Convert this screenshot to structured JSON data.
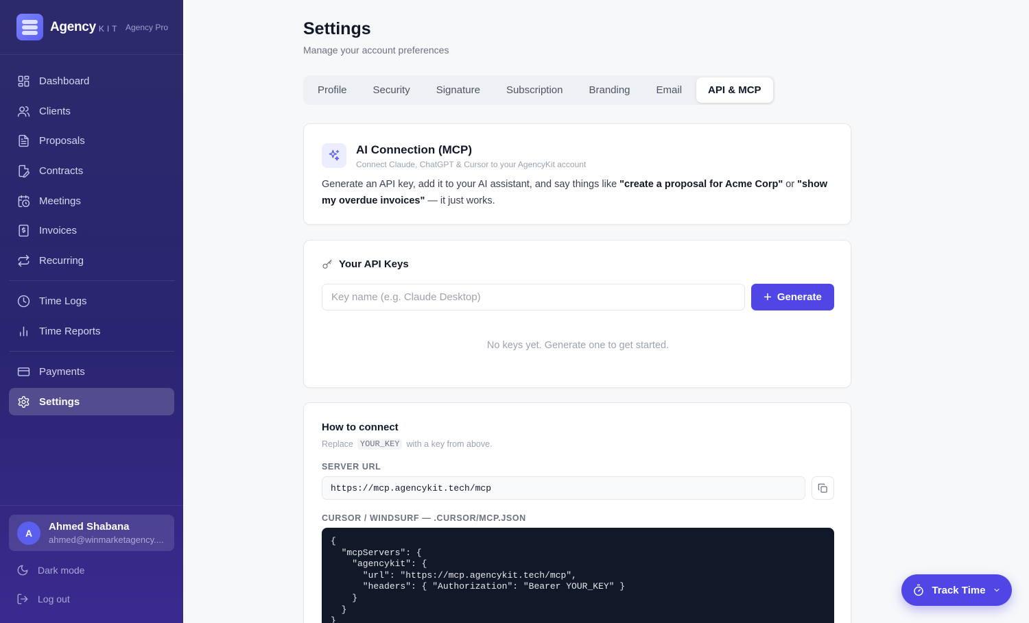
{
  "brand": {
    "name": "Agency",
    "suffix": "KIT",
    "plan": "Agency Pro"
  },
  "nav": {
    "items": [
      {
        "label": "Dashboard",
        "icon": "dashboard-icon"
      },
      {
        "label": "Clients",
        "icon": "users-icon"
      },
      {
        "label": "Proposals",
        "icon": "document-icon"
      },
      {
        "label": "Contracts",
        "icon": "contract-icon"
      },
      {
        "label": "Meetings",
        "icon": "calendar-clock-icon"
      },
      {
        "label": "Invoices",
        "icon": "invoice-icon"
      },
      {
        "label": "Recurring",
        "icon": "repeat-icon"
      },
      {
        "label": "Time Logs",
        "icon": "clock-icon"
      },
      {
        "label": "Time Reports",
        "icon": "bar-chart-icon"
      },
      {
        "label": "Payments",
        "icon": "credit-card-icon"
      },
      {
        "label": "Settings",
        "icon": "gear-icon",
        "active": true
      }
    ]
  },
  "user": {
    "initial": "A",
    "name": "Ahmed Shabana",
    "email": "ahmed@winmarketagency...."
  },
  "footer": {
    "dark_mode": "Dark mode",
    "logout": "Log out"
  },
  "page": {
    "title": "Settings",
    "subtitle": "Manage your account preferences"
  },
  "tabs": [
    "Profile",
    "Security",
    "Signature",
    "Subscription",
    "Branding",
    "Email",
    "API & MCP"
  ],
  "active_tab": "API & MCP",
  "mcp": {
    "title": "AI Connection (MCP)",
    "subtitle": "Connect Claude, ChatGPT & Cursor to your AgencyKit account",
    "desc_part1": "Generate an API key, add it to your AI assistant, and say things like ",
    "desc_bold1": "\"create a proposal for Acme Corp\"",
    "desc_part2": " or ",
    "desc_bold2": "\"show my overdue invoices\"",
    "desc_part3": " — it just works."
  },
  "keys": {
    "title": "Your API Keys",
    "placeholder": "Key name (e.g. Claude Desktop)",
    "value": "",
    "generate_label": "Generate",
    "empty": "No keys yet. Generate one to get started."
  },
  "howto": {
    "title": "How to connect",
    "sub_before": "Replace",
    "sub_code": "YOUR_KEY",
    "sub_after": "with a key from above.",
    "server_url_label": "SERVER URL",
    "server_url": "https://mcp.agencykit.tech/mcp",
    "cursor_label": "CURSOR / WINDSURF — .CURSOR/MCP.JSON",
    "code_lines": [
      "{",
      "  \"mcpServers\": {",
      "    \"agencykit\": {",
      "      \"url\": \"https://mcp.agencykit.tech/mcp\",",
      "      \"headers\": { \"Authorization\": \"Bearer YOUR_KEY\" }",
      "    }",
      "  }",
      "}"
    ]
  },
  "track": {
    "label": "Track Time"
  },
  "colors": {
    "accent": "#4f46e5",
    "sidebar": "#2a2570"
  }
}
